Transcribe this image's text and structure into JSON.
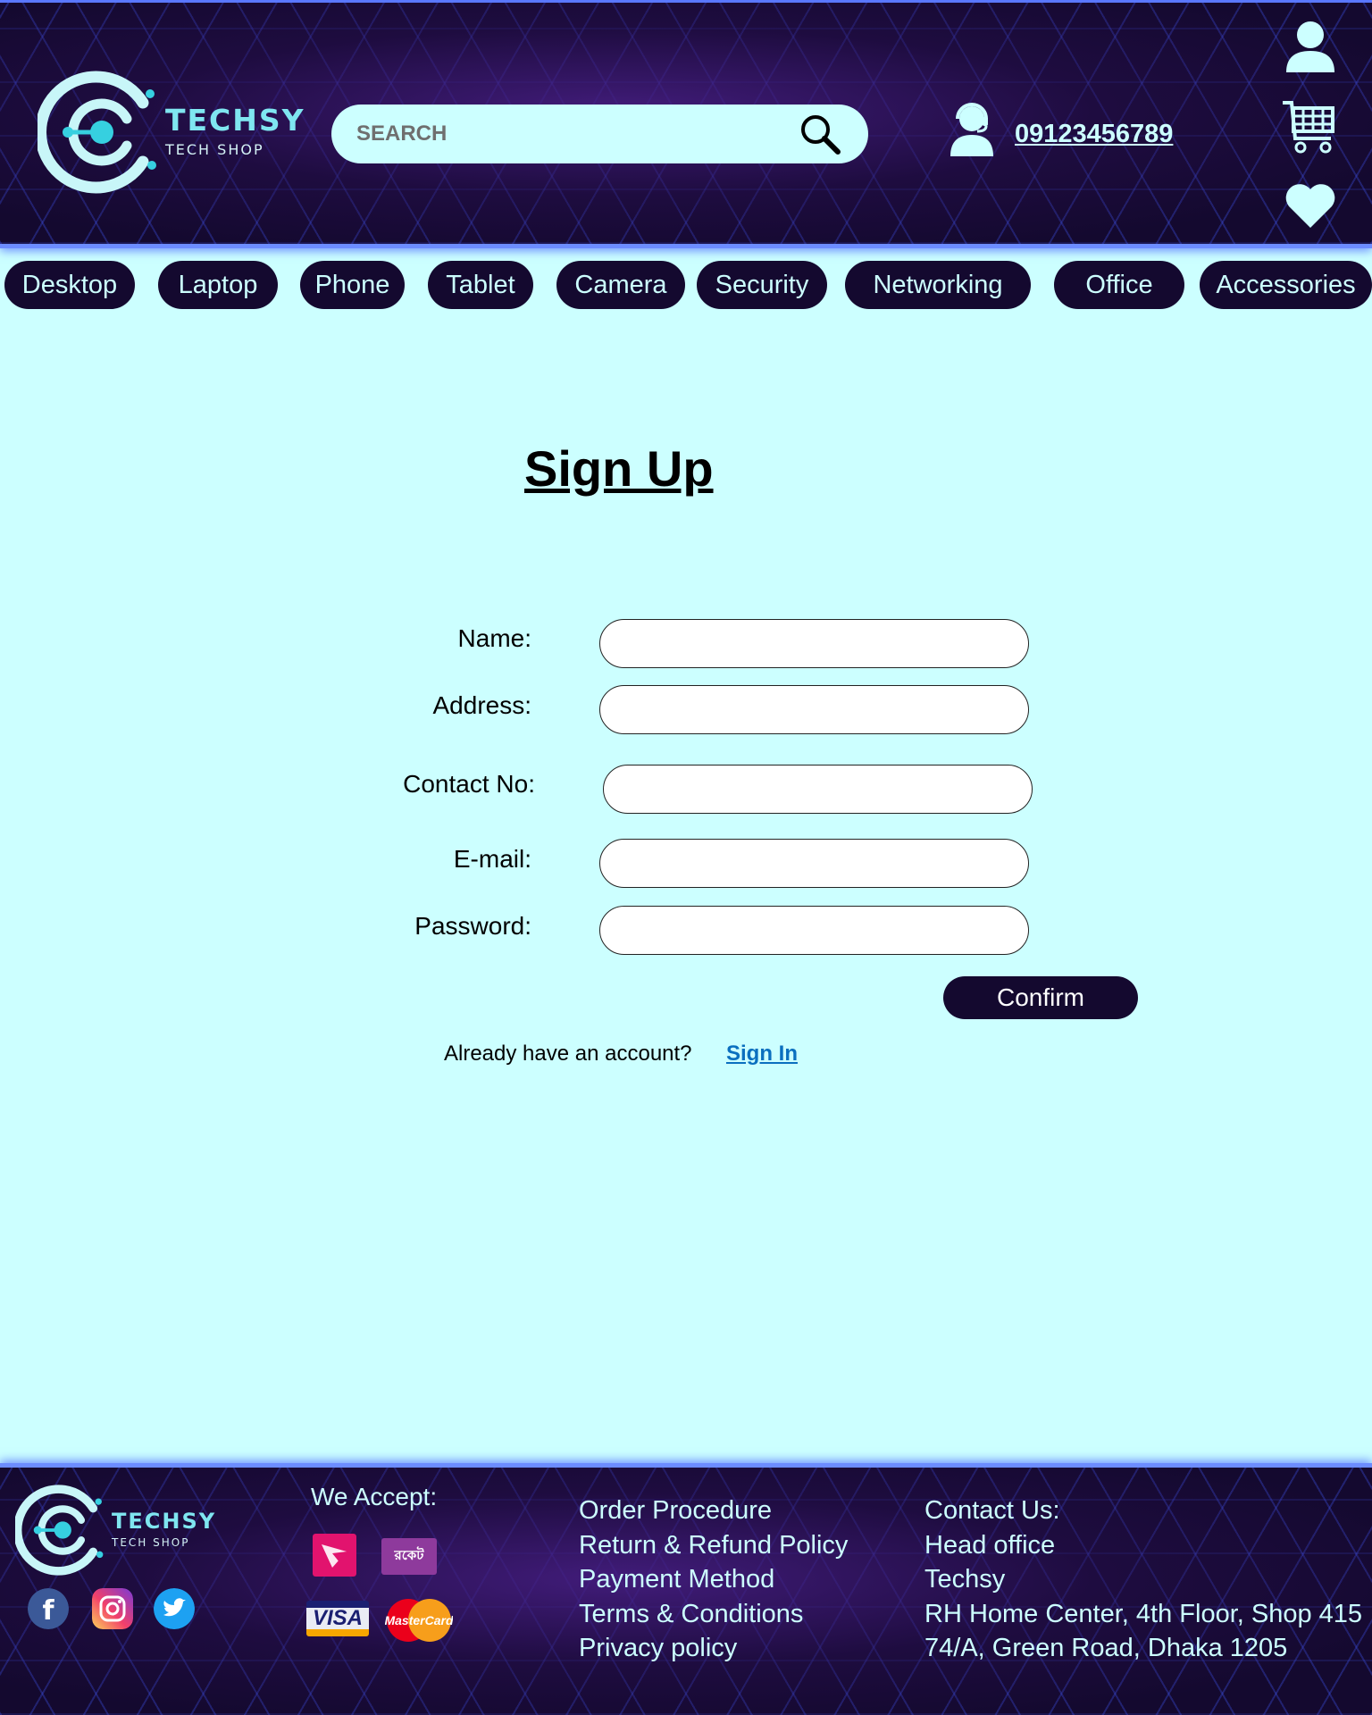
{
  "brand": {
    "name": "TECHSY",
    "tagline": "TECH SHOP"
  },
  "header": {
    "search_placeholder": "SEARCH",
    "phone": "09123456789",
    "icons": [
      "search-icon",
      "support-agent-icon",
      "user-icon",
      "cart-icon",
      "heart-icon"
    ]
  },
  "nav": {
    "items": [
      "Desktop",
      "Laptop",
      "Phone",
      "Tablet",
      "Camera",
      "Security",
      "Networking",
      "Office",
      "Accessories"
    ]
  },
  "form": {
    "title": "Sign Up",
    "fields": [
      {
        "label": "Name:",
        "value": ""
      },
      {
        "label": "Address:",
        "value": ""
      },
      {
        "label": "Contact No:",
        "value": ""
      },
      {
        "label": "E-mail:",
        "value": ""
      },
      {
        "label": "Password:",
        "value": ""
      }
    ],
    "confirm_label": "Confirm",
    "already_text": "Already have an account?",
    "signin_label": "Sign In"
  },
  "footer": {
    "we_accept": "We Accept:",
    "payment_methods": [
      "bkash-icon",
      "rocket-icon",
      "visa-icon",
      "mastercard-icon"
    ],
    "rocket_text": "রকেট",
    "visa_text": "VISA",
    "mastercard_text": "MasterCard",
    "socials": [
      "facebook-icon",
      "instagram-icon",
      "twitter-icon"
    ],
    "links": [
      "Order Procedure",
      "Return & Refund Policy",
      "Payment Method",
      "Terms & Conditions",
      "Privacy policy"
    ],
    "contact": [
      "Contact Us:",
      "Head office",
      "Techsy",
      "RH Home Center, 4th Floor, Shop 415",
      "74/A, Green Road, Dhaka 1205"
    ]
  },
  "colors": {
    "page_bg": "#ccffff",
    "dark": "#14092f",
    "accent": "#7fe6f0",
    "link": "#0a6fbf"
  }
}
